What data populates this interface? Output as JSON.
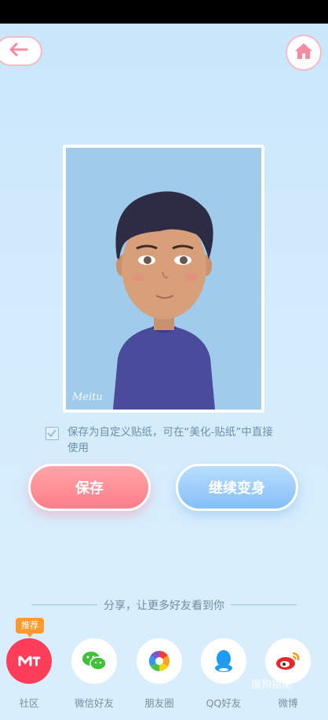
{
  "checkbox": {
    "checked": true,
    "label": "保存为自定义贴纸，可在“美化-贴纸”中直接使用"
  },
  "buttons": {
    "save": "保存",
    "transform": "继续变身"
  },
  "share": {
    "title": "分享，让更多好友看到你",
    "items": [
      {
        "label": "社区",
        "badge": "推荐"
      },
      {
        "label": "微信好友"
      },
      {
        "label": "朋友圈"
      },
      {
        "label": "QQ好友"
      },
      {
        "label": "微博"
      }
    ]
  },
  "avatar": {
    "watermark": "Meitu"
  },
  "watermark": {
    "text": "搜狗指南"
  },
  "colors": {
    "pink_accent": "#ff7e8a",
    "blue_accent": "#85c0f6",
    "background": "#c9e6fb"
  }
}
